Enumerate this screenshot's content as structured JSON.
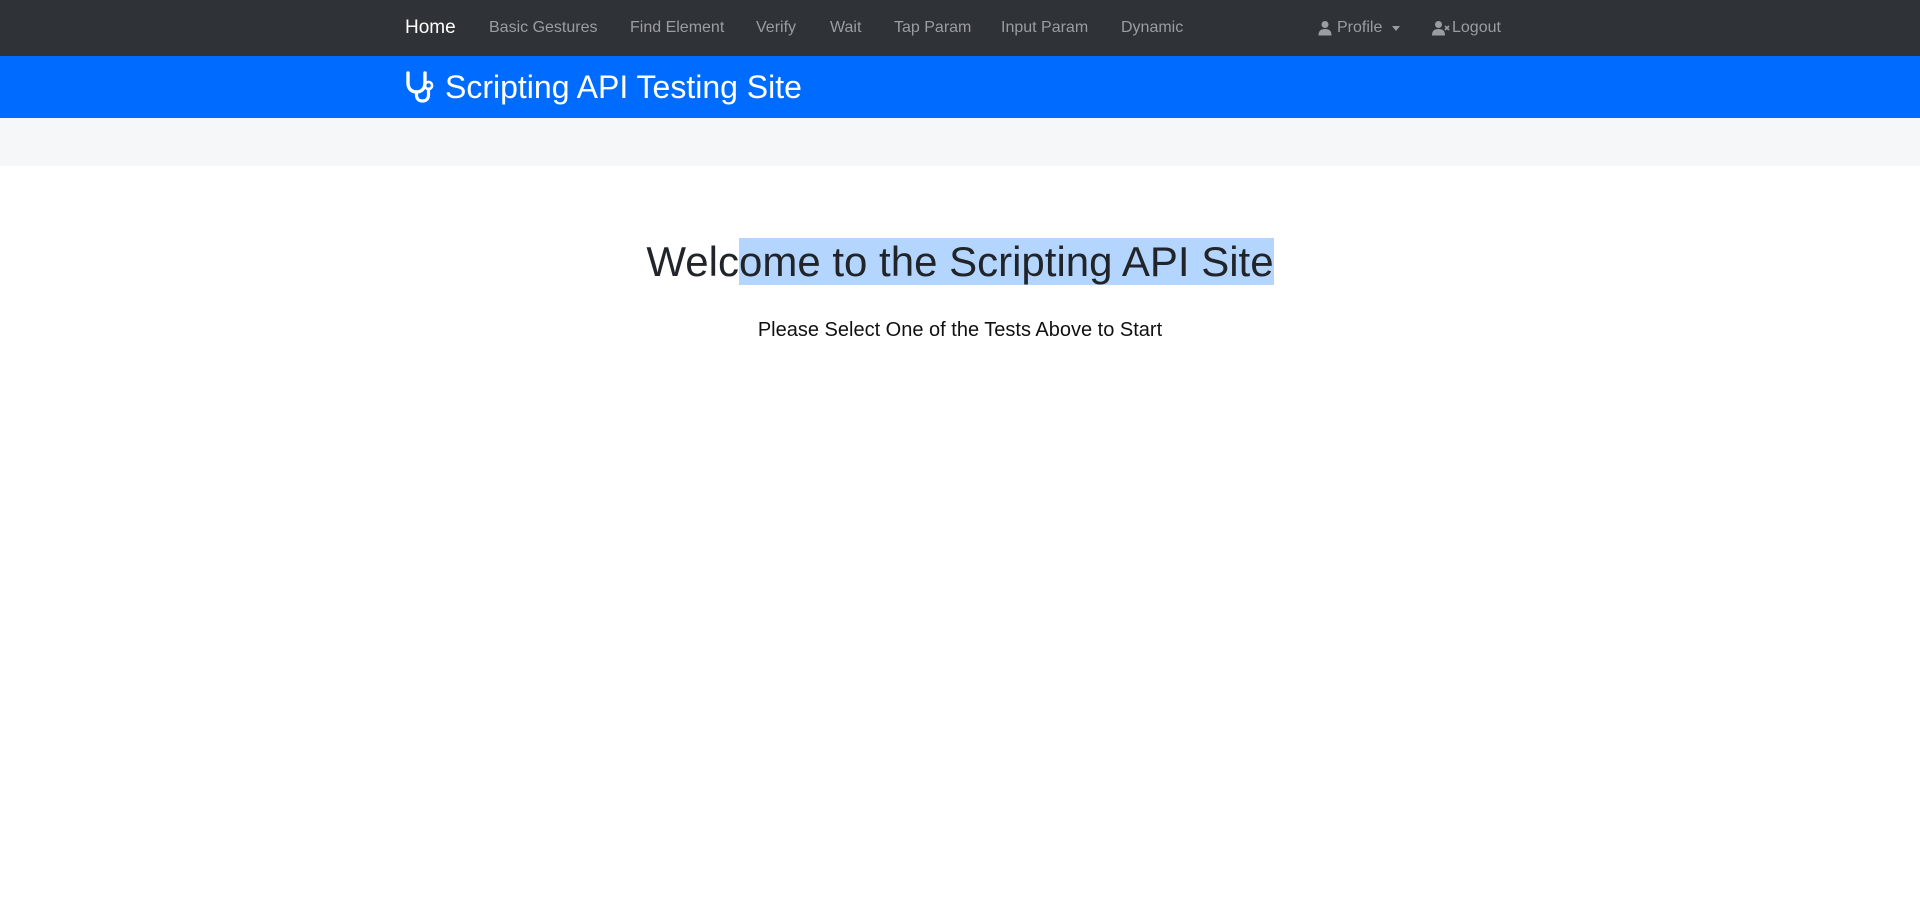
{
  "nav": {
    "home": "Home",
    "items": [
      {
        "label": "Basic Gestures"
      },
      {
        "label": "Find Element"
      },
      {
        "label": "Verify"
      },
      {
        "label": "Wait"
      },
      {
        "label": "Tap Param"
      },
      {
        "label": "Input Param"
      },
      {
        "label": "Dynamic"
      }
    ],
    "profile_label": "Profile",
    "logout_label": "Logout",
    "profile_icon": "user-icon",
    "logout_icon": "user-times-icon",
    "background_color": "#2f3237",
    "link_color": "#9a9da1"
  },
  "banner": {
    "icon": "stethoscope-icon",
    "title": "Scripting API Testing Site",
    "background_color": "#006cff"
  },
  "main": {
    "heading_plain": "Welc",
    "heading_selected": "ome to the Scripting API Site",
    "subtitle": "Please Select One of the Tests Above to Start",
    "selection_color": "#b4d5fe"
  }
}
